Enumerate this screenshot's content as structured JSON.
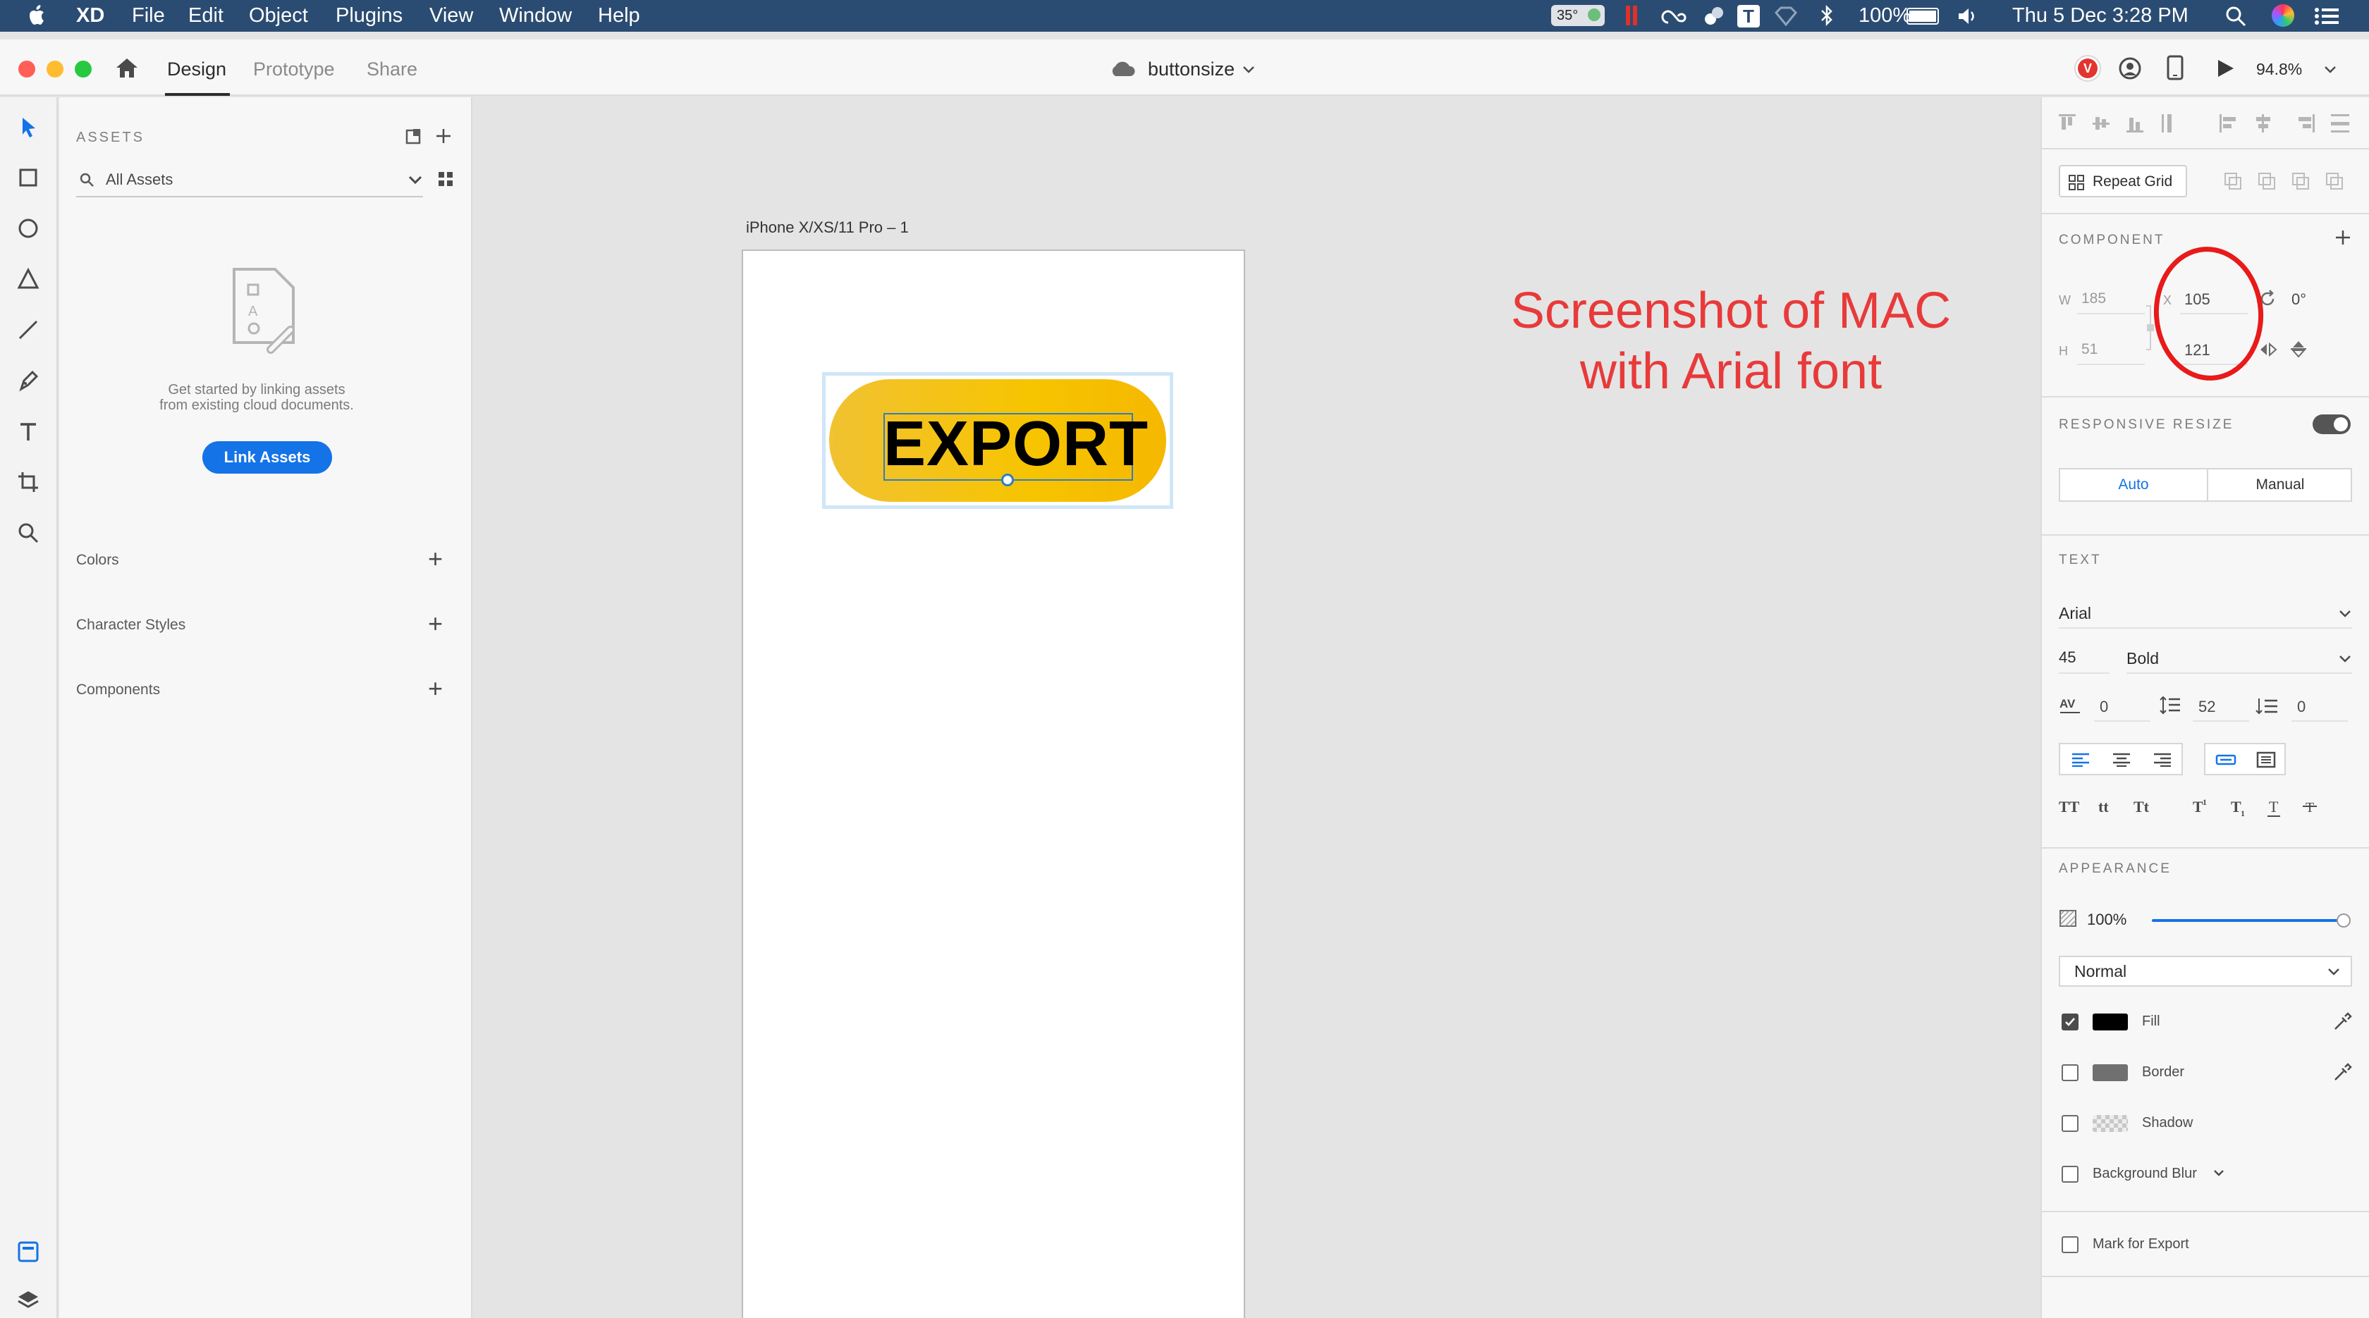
{
  "menubar": {
    "app": "XD",
    "items": [
      "File",
      "Edit",
      "Object",
      "Plugins",
      "View",
      "Window",
      "Help"
    ],
    "temperature": "35°",
    "battery": "100%",
    "clock": "Thu 5 Dec  3:28 PM"
  },
  "titlebar": {
    "tabs": [
      "Design",
      "Prototype",
      "Share"
    ],
    "active_tab": "Design",
    "document": "buttonsize",
    "zoom": "94.8%",
    "user_initial": "V"
  },
  "assets": {
    "header": "ASSETS",
    "filter": "All Assets",
    "empty_text_1": "Get started by linking assets",
    "empty_text_2": "from existing cloud documents.",
    "link_button": "Link Assets",
    "sections": [
      "Colors",
      "Character Styles",
      "Components"
    ]
  },
  "canvas": {
    "artboard_name": "iPhone X/XS/11 Pro – 1",
    "button_text": "EXPORT",
    "note_line_1": "Screenshot of MAC",
    "note_line_2": "with Arial font"
  },
  "inspector": {
    "repeat_grid": "Repeat Grid",
    "component_caption": "COMPONENT",
    "w_label": "W",
    "w_value": "185",
    "h_label": "H",
    "h_value": "51",
    "x_label": "X",
    "x_value": "105",
    "y_value": "121",
    "rotation": "0°",
    "responsive_caption": "RESPONSIVE RESIZE",
    "responsive_on": true,
    "resize_auto": "Auto",
    "resize_manual": "Manual",
    "text_caption": "TEXT",
    "font_family": "Arial",
    "font_size": "45",
    "font_weight": "Bold",
    "char_spacing": "0",
    "line_spacing": "52",
    "para_spacing": "0",
    "appearance_caption": "APPEARANCE",
    "opacity": "100%",
    "opacity_fraction": 1.0,
    "blend_mode": "Normal",
    "fill_label": "Fill",
    "fill_enabled": true,
    "fill_color": "#000000",
    "border_label": "Border",
    "border_enabled": false,
    "border_color": "#707070",
    "shadow_label": "Shadow",
    "shadow_enabled": false,
    "blur_label": "Background Blur",
    "blur_enabled": false,
    "export_label": "Mark for Export",
    "export_enabled": false
  },
  "colors": {
    "menubar_bg": "#2b4c72",
    "accent_blue": "#1473e6",
    "button_yellow": "#f7c400",
    "annotation_red": "#e83a3a"
  }
}
